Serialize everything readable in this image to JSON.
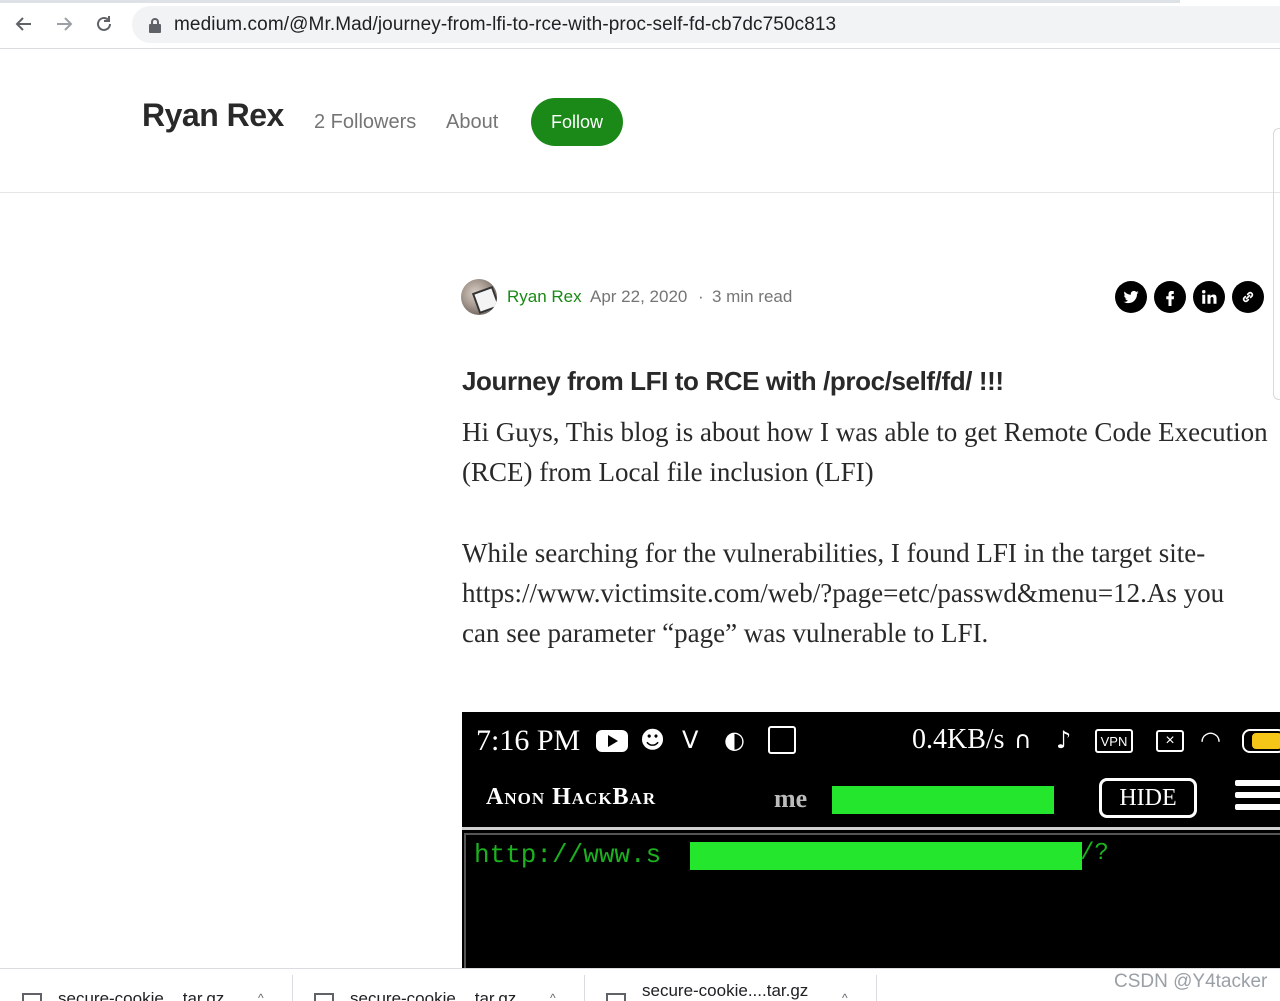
{
  "browser": {
    "url": "medium.com/@Mr.Mad/journey-from-lfi-to-rce-with-proc-self-fd-cb7dc750c813",
    "icons": [
      "back-icon",
      "forward-icon",
      "reload-icon",
      "lock-icon"
    ]
  },
  "header": {
    "author": "Ryan Rex",
    "followers": "2 Followers",
    "about": "About",
    "follow": "Follow"
  },
  "byline": {
    "name": "Ryan Rex",
    "date": "Apr 22, 2020",
    "dot": "·",
    "read_time": "3 min read"
  },
  "share": {
    "icons": [
      "twitter-icon",
      "facebook-icon",
      "linkedin-icon",
      "link-icon"
    ]
  },
  "article": {
    "title": "Journey from LFI to RCE with /proc/self/fd/ !!!",
    "p1_line1": "Hi Guys, This blog is about how I was able to get Remote Code Execution",
    "p1_line2": "(RCE) from Local file inclusion (LFI)",
    "p2_line1": "While searching for the vulnerabilities, I found LFI in the target site-",
    "p2_line2": "https://www.victimsite.com/web/?page=etc/passwd&menu=12.As you",
    "p2_line3": "can see parameter “page” was vulnerable to LFI."
  },
  "embedded_screenshot": {
    "time": "7:16 PM",
    "speed": "0.4KB/s",
    "vpn": "VPN",
    "close": "×",
    "battery": "65",
    "app_title": "Anon HackBar",
    "partial_text": "me",
    "hide_button": "HIDE",
    "url_prefix": "http://www.s",
    "url_suffix": "/?",
    "redaction_color": "#23e62d"
  },
  "downloads": {
    "items": [
      "secure-cookie....tar.gz",
      "secure-cookie....tar.gz",
      "secure-cookie....tar.gz"
    ]
  },
  "watermark": "CSDN @Y4tacker",
  "colors": {
    "follow_green": "#1a8917",
    "text": "#292929",
    "muted": "#757575"
  }
}
